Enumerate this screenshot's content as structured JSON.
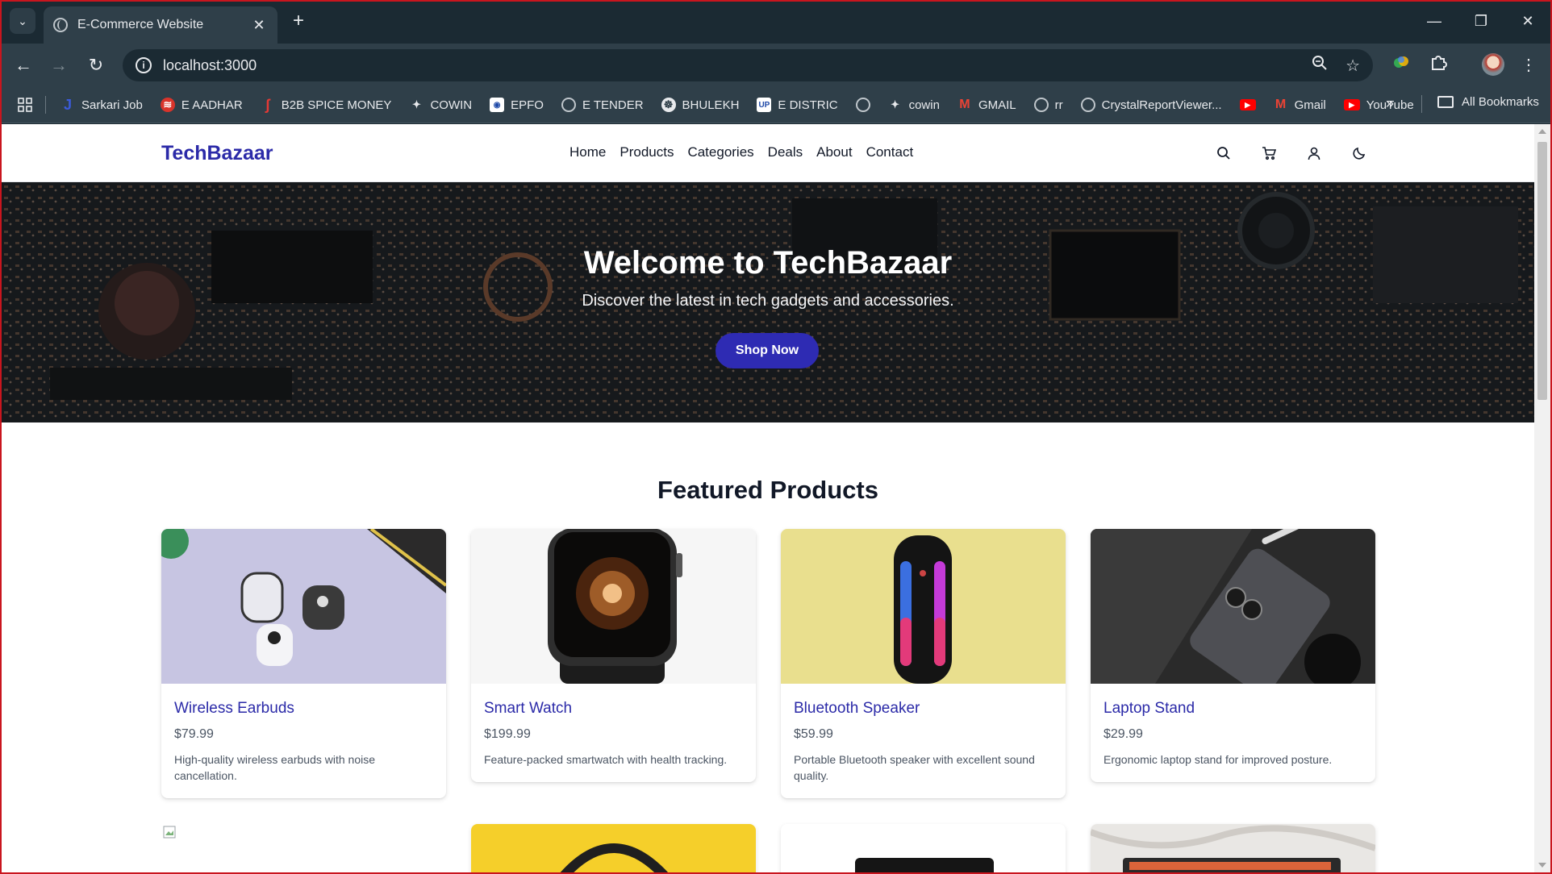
{
  "browser": {
    "tab_title": "E-Commerce Website",
    "url": "localhost:3000",
    "bookmarks": [
      {
        "label": "Sarkari Job",
        "icon": "j-icon"
      },
      {
        "label": "E AADHAR",
        "icon": "aadhar-icon"
      },
      {
        "label": "B2B SPICE MONEY",
        "icon": "spice-money-icon"
      },
      {
        "label": "COWIN",
        "icon": "sparkle-icon"
      },
      {
        "label": "EPFO",
        "icon": "epfo-icon"
      },
      {
        "label": "E TENDER",
        "icon": "globe-icon"
      },
      {
        "label": "BHULEKH",
        "icon": "bhulekh-icon"
      },
      {
        "label": "E DISTRIC",
        "icon": "up-icon"
      },
      {
        "label": "",
        "icon": "globe-icon"
      },
      {
        "label": "cowin",
        "icon": "sparkle-icon"
      },
      {
        "label": "GMAIL",
        "icon": "gmail-icon"
      },
      {
        "label": "rr",
        "icon": "globe-icon"
      },
      {
        "label": "CrystalReportViewer...",
        "icon": "globe-icon"
      },
      {
        "label": "",
        "icon": "youtube-icon"
      },
      {
        "label": "Gmail",
        "icon": "gmail-icon"
      },
      {
        "label": "YouTube",
        "icon": "youtube-icon"
      }
    ],
    "all_bookmarks": "All Bookmarks",
    "more": "»"
  },
  "site": {
    "logo": "TechBazaar",
    "nav": [
      "Home",
      "Products",
      "Categories",
      "Deals",
      "About",
      "Contact"
    ],
    "hero": {
      "title": "Welcome to TechBazaar",
      "subtitle": "Discover the latest in tech gadgets and accessories.",
      "cta": "Shop Now"
    },
    "featured_title": "Featured Products",
    "products": [
      {
        "name": "Wireless Earbuds",
        "price": "$79.99",
        "desc": "High-quality wireless earbuds with noise cancellation."
      },
      {
        "name": "Smart Watch",
        "price": "$199.99",
        "desc": "Feature-packed smartwatch with health tracking."
      },
      {
        "name": "Bluetooth Speaker",
        "price": "$59.99",
        "desc": "Portable Bluetooth speaker with excellent sound quality."
      },
      {
        "name": "Laptop Stand",
        "price": "$29.99",
        "desc": "Ergonomic laptop stand for improved posture."
      }
    ]
  },
  "colors": {
    "brand": "#2b2aa8",
    "cta": "#2e2bb3",
    "chrome_dark": "#1b2a33",
    "chrome_toolbar": "#2f3f49"
  }
}
